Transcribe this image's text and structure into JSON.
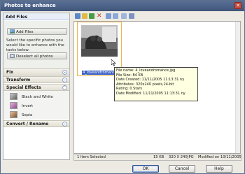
{
  "window": {
    "title": "Photos to enhance",
    "close_glyph": "✕"
  },
  "left_pane": {
    "heading": "Add Files",
    "add_files_label": "Add Files",
    "help_text": "Select the specific photos you would like to enhance with the tasks below.",
    "deselect_label": "Deselect all photos",
    "sections": [
      {
        "label": "Fix"
      },
      {
        "label": "Transform"
      },
      {
        "label": "Special Effects"
      },
      {
        "label": "Convert / Rename"
      }
    ],
    "effects": [
      {
        "label": "Black and White",
        "thumb_color": "#8c8c8c"
      },
      {
        "label": "Invert",
        "thumb_color": "#c987b8"
      },
      {
        "label": "Sepia",
        "thumb_color": "#b07a55"
      }
    ]
  },
  "toolbar": {
    "icons": [
      "view-icon",
      "folder-icon",
      "refresh-icon",
      "delete-icon",
      "thumbnail-icon",
      "list-icon",
      "details-icon",
      "scan-icon"
    ]
  },
  "thumbnail": {
    "filename": "4_loveandromance.jpg"
  },
  "tooltip": {
    "lines": [
      "File name: 4_loveandromance.jpg",
      "File Size: 84 KB",
      "Date Created: 11/11/2005 11:13:31 ny",
      "Attributes: 320x240 pixels,24-bit",
      "Rating: 0 Stars",
      "Date Modified: 11/11/2005 11:13:31 ny"
    ]
  },
  "statusbar": {
    "selected": "1 Item Selected",
    "size": "15 KB",
    "dimensions": "320 X 240",
    "format": "JPG",
    "modified": "Modified on 10/11/2005"
  },
  "buttons": {
    "ok": "OK",
    "cancel": "Cancel",
    "help": "Help"
  },
  "colors": {
    "title_bar": "#4d6389",
    "selection": "#3a5fc4",
    "thumb_border": "#f0b64a"
  }
}
